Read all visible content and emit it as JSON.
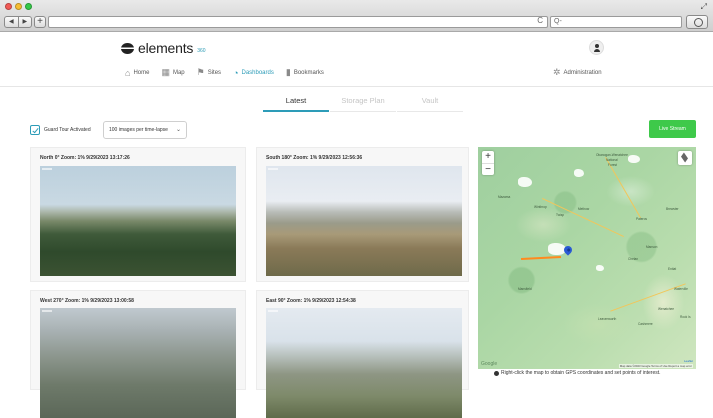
{
  "browser": {
    "url": "",
    "search_placeholder": "Q-",
    "back_glyph": "◀",
    "forward_glyph": "▶",
    "new_tab_glyph": "+",
    "reload_glyph": "C",
    "resize_glyph": "⤢"
  },
  "brand": {
    "name": "elements",
    "suffix": "360"
  },
  "nav": {
    "items": [
      {
        "label": "Home",
        "icon": "home-icon",
        "glyph": "⌂"
      },
      {
        "label": "Map",
        "icon": "map-icon",
        "glyph": "▦"
      },
      {
        "label": "Sites",
        "icon": "sites-icon",
        "glyph": "⚑"
      },
      {
        "label": "Dashboards",
        "icon": "dashboard-icon",
        "glyph": "◔"
      },
      {
        "label": "Bookmarks",
        "icon": "bookmark-icon",
        "glyph": "▮"
      }
    ],
    "active": "Dashboards",
    "admin_label": "Administration",
    "admin_glyph": "✲"
  },
  "tabs": [
    {
      "label": "Latest",
      "active": true
    },
    {
      "label": "Storage Plan",
      "active": false
    },
    {
      "label": "Vault",
      "active": false
    }
  ],
  "controls": {
    "guard_tour_label": "Guard Tour Activated",
    "guard_tour_checked": true,
    "images_select_value": "100 images per time-lapse",
    "chevron": "⌄",
    "live_stream_label": "Live Stream"
  },
  "cameras": [
    {
      "title": "North 0°  Zoom: 1%   9/29/2023  13:17:26"
    },
    {
      "title": "South 180°  Zoom: 1%   9/29/2023  12:56:36"
    },
    {
      "title": "West 270°  Zoom: 1%   9/29/2023  13:00:58"
    },
    {
      "title": "East 90°  Zoom: 1%   9/29/2023  12:54:38"
    }
  ],
  "map": {
    "zoom_in": "+",
    "zoom_out": "−",
    "labels": [
      "Okanogan-Wenatchee",
      "National",
      "Forest",
      "Mazama",
      "Winthrop",
      "Twisp",
      "Methow",
      "Pateros",
      "Brewster",
      "Chelan",
      "Manson",
      "Entiat",
      "Wenatchee",
      "Leavenworth",
      "Cashmere",
      "Waterville",
      "Rock Is",
      "Mansfield"
    ],
    "attribution": "Map data ©2023 Google   Terms of Use   Report a map error",
    "leaflet": "Leaflet",
    "google": "Google",
    "hint": "Right-click the map to obtain GPS coordinates and set points of interest."
  }
}
